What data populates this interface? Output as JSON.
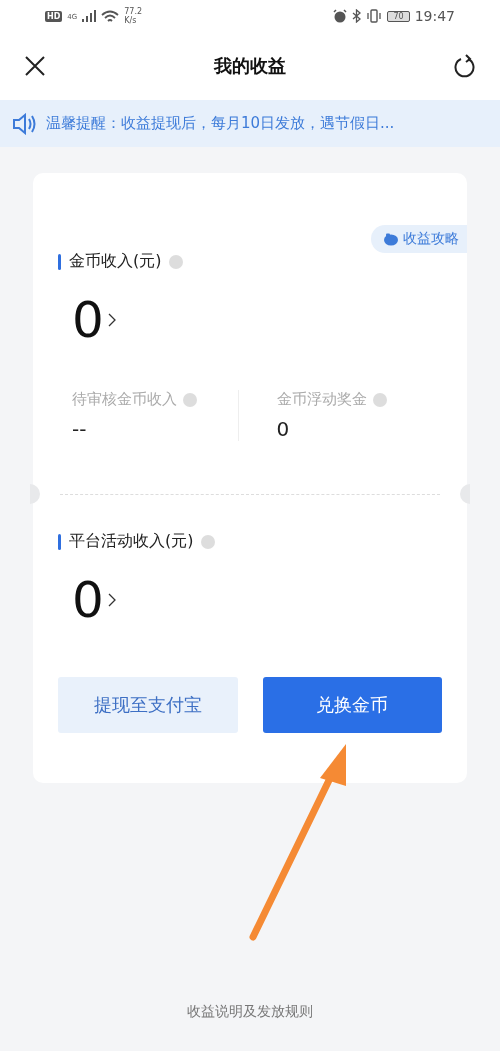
{
  "status_bar": {
    "hd": "HD",
    "network": "4G",
    "speed": "77.2",
    "speed_unit": "K/s",
    "battery": "70",
    "time": "19:47"
  },
  "header": {
    "title": "我的收益"
  },
  "notice": {
    "text": "温馨提醒：收益提现后，每月10日发放，遇节假日..."
  },
  "card": {
    "guide_button": "收益攻略",
    "sections": [
      {
        "title": "金币收入(元)",
        "amount": "0",
        "stats": [
          {
            "label": "待审核金币收入",
            "value": "--"
          },
          {
            "label": "金币浮动奖金",
            "value": "0"
          }
        ]
      },
      {
        "title": "平台活动收入(元)",
        "amount": "0"
      }
    ],
    "buttons": [
      {
        "label": "提现至支付宝",
        "kind": "secondary"
      },
      {
        "label": "兑换金币",
        "kind": "primary"
      }
    ]
  },
  "footer": {
    "link": "收益说明及发放规则"
  }
}
